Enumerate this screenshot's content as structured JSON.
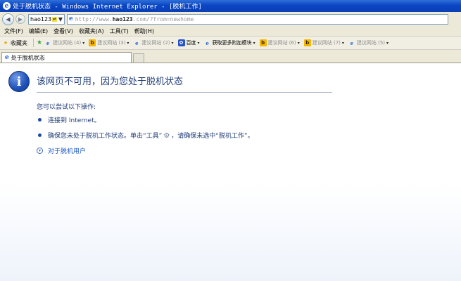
{
  "window": {
    "title": "处于脱机状态 - Windows Internet Explorer - [脱机工作]"
  },
  "address_bar": {
    "search_combo_value": "hao123",
    "url_prefix": "http://www.",
    "url_host": "hao123",
    "url_suffix": ".com/",
    "url_query": "?from=newhome"
  },
  "menu": [
    "文件(F)",
    "编辑(E)",
    "查看(V)",
    "收藏夹(A)",
    "工具(T)",
    "帮助(H)"
  ],
  "favorites": {
    "label": "收藏夹",
    "items": [
      {
        "icon": "ie-icon",
        "label": "建议网站 (4)",
        "grey": true
      },
      {
        "icon": "bing-icon",
        "label": "建议网站 (3)",
        "grey": true
      },
      {
        "icon": "ie-icon",
        "label": "建议网站 (2)",
        "grey": true
      },
      {
        "icon": "baidu-paw-icon",
        "label": "百度",
        "grey": false
      },
      {
        "icon": "ie-icon",
        "label": "获取更多附加模块",
        "grey": false
      },
      {
        "icon": "bing-icon",
        "label": "建议网站 (6)",
        "grey": true
      },
      {
        "icon": "bing-icon",
        "label": "建议网站 (7)",
        "grey": true
      },
      {
        "icon": "ie-icon",
        "label": "建议网站 (5)",
        "grey": true
      }
    ]
  },
  "tab": {
    "label": "处于脱机状态"
  },
  "content": {
    "headline": "该网页不可用，因为您处于脱机状态",
    "try_label": "您可以尝试以下操作:",
    "bullet1": "连接到 Internet。",
    "bullet2_a": "确保您未处于脱机工作状态。单击“工具”",
    "bullet2_b": "，请确保未选中“脱机工作”。",
    "link": "对于脱机用户"
  }
}
